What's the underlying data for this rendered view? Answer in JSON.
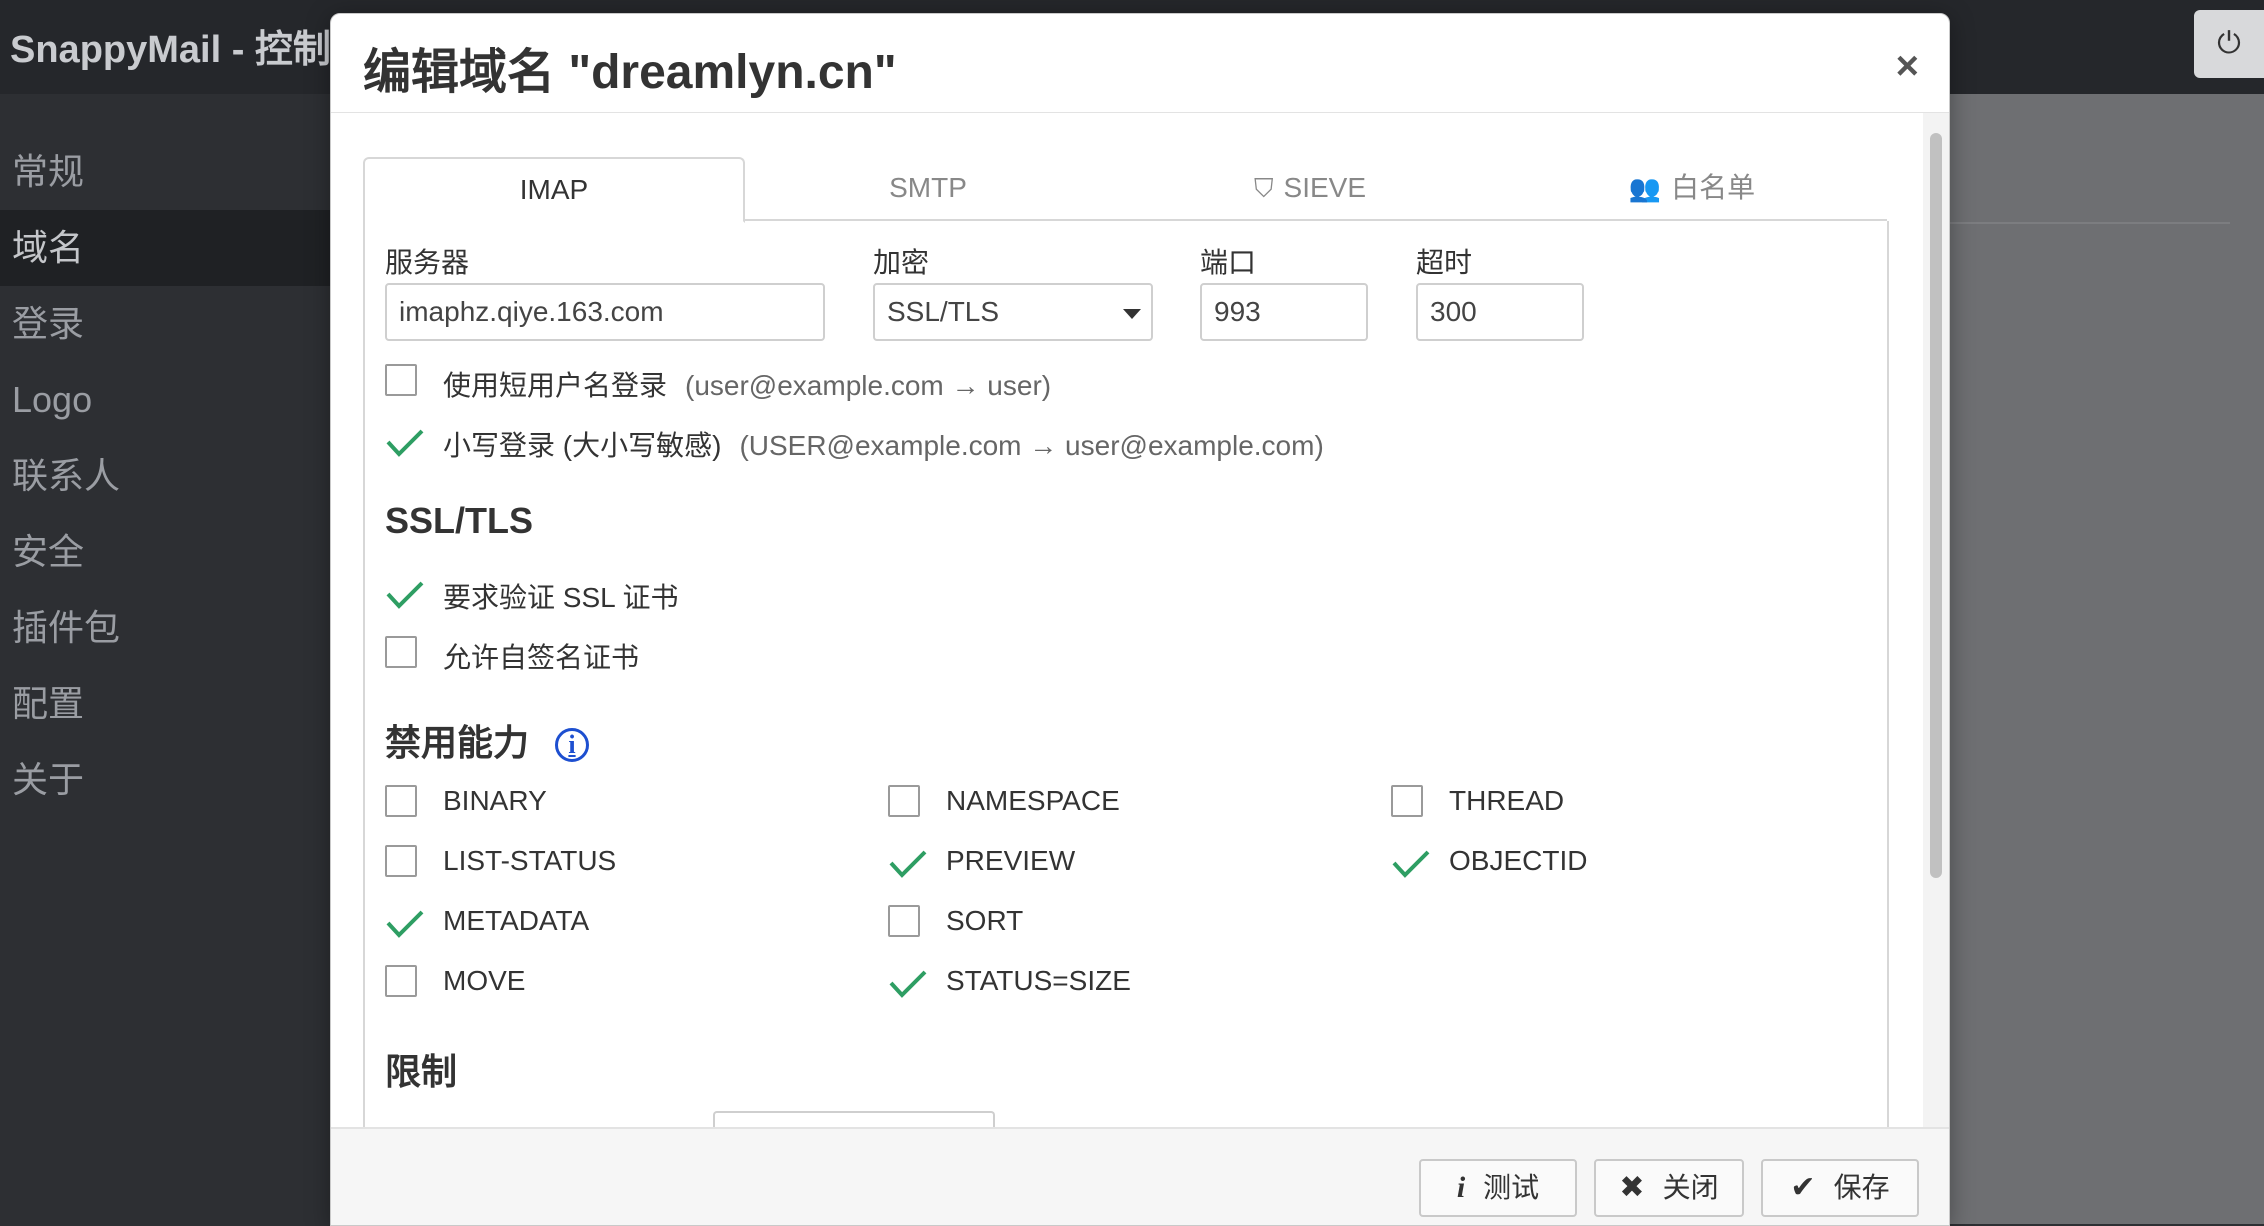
{
  "app": {
    "title": "SnappyMail - 控制面",
    "logout_icon": "⏻"
  },
  "sidebar": {
    "items": [
      {
        "label": "常规"
      },
      {
        "label": "域名"
      },
      {
        "label": "登录"
      },
      {
        "label": "Logo"
      },
      {
        "label": "联系人"
      },
      {
        "label": "安全"
      },
      {
        "label": "插件包"
      },
      {
        "label": "配置"
      },
      {
        "label": "关于"
      }
    ]
  },
  "modal": {
    "title": "编辑域名 \"dreamlyn.cn\"",
    "close_glyph": "×",
    "tabs": [
      {
        "label": "IMAP",
        "icon": ""
      },
      {
        "label": "SMTP",
        "icon": ""
      },
      {
        "label": "SIEVE",
        "icon": "⛉"
      },
      {
        "label": "白名单",
        "icon": "👥"
      }
    ],
    "fields": {
      "server": {
        "label": "服务器",
        "value": "imaphz.qiye.163.com"
      },
      "encryption": {
        "label": "加密",
        "value": "SSL/TLS"
      },
      "port": {
        "label": "端口",
        "value": "993"
      },
      "timeout": {
        "label": "超时",
        "value": "300"
      }
    },
    "login_options": {
      "short_login": {
        "label": "使用短用户名登录",
        "hint": "(user@example.com → user)",
        "checked": false
      },
      "lowercase": {
        "label": "小写登录 (大小写敏感)",
        "hint": "(USER@example.com → user@example.com)",
        "checked": true
      }
    },
    "ssl_section": {
      "title": "SSL/TLS",
      "verify": {
        "label": "要求验证 SSL 证书",
        "checked": true
      },
      "self_signed": {
        "label": "允许自签名证书",
        "checked": false
      }
    },
    "disable_caps": {
      "title": "禁用能力",
      "info_glyph": "i",
      "items": [
        {
          "label": "BINARY",
          "checked": false
        },
        {
          "label": "LIST-STATUS",
          "checked": false
        },
        {
          "label": "METADATA",
          "checked": true
        },
        {
          "label": "MOVE",
          "checked": false
        },
        {
          "label": "NAMESPACE",
          "checked": false
        },
        {
          "label": "PREVIEW",
          "checked": true
        },
        {
          "label": "SORT",
          "checked": false
        },
        {
          "label": "STATUS=SIZE",
          "checked": true
        },
        {
          "label": "THREAD",
          "checked": false
        },
        {
          "label": "OBJECTID",
          "checked": true
        }
      ]
    },
    "limits_section": {
      "title": "限制"
    },
    "footer": {
      "test": {
        "icon": "i",
        "label": "测试"
      },
      "close": {
        "icon": "✖",
        "label": "关闭"
      },
      "save": {
        "icon": "✔",
        "label": "保存"
      }
    }
  },
  "colors": {
    "check_green": "#2e9e63",
    "info_blue": "#1d4fd0",
    "sidebar_bg": "#2d2f33"
  }
}
